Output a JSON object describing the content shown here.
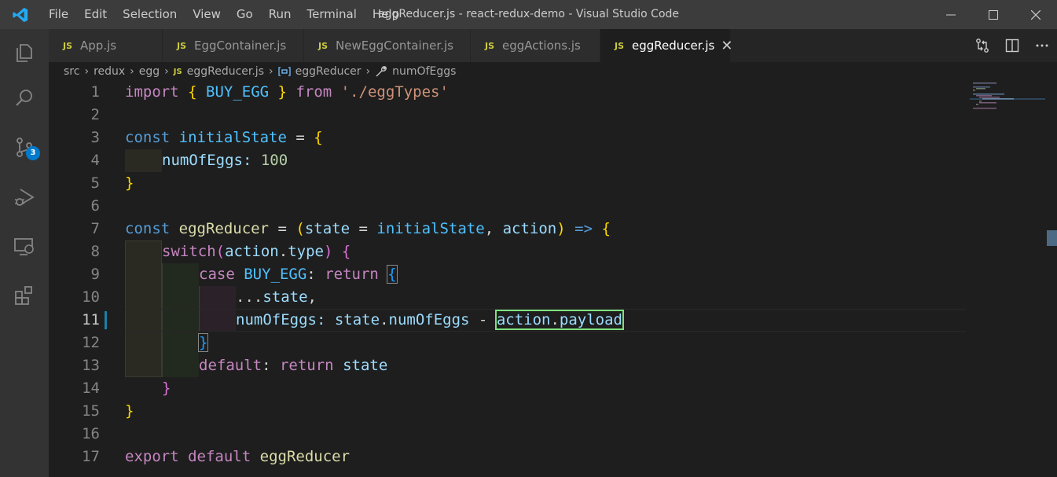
{
  "window": {
    "title": "eggReducer.js - react-redux-demo - Visual Studio Code"
  },
  "menu": [
    "File",
    "Edit",
    "Selection",
    "View",
    "Go",
    "Run",
    "Terminal",
    "Help"
  ],
  "activity": {
    "source_control_badge": "3"
  },
  "tabs": [
    {
      "label": "App.js",
      "icon": "JS"
    },
    {
      "label": "EggContainer.js",
      "icon": "JS"
    },
    {
      "label": "NewEggContainer.js",
      "icon": "JS"
    },
    {
      "label": "eggActions.js",
      "icon": "JS"
    },
    {
      "label": "eggReducer.js",
      "icon": "JS",
      "active": true
    }
  ],
  "breadcrumb": {
    "parts": [
      "src",
      "redux",
      "egg",
      "eggReducer.js",
      "eggReducer",
      "numOfEggs"
    ],
    "js_icon": "JS"
  },
  "editor": {
    "line_numbers": [
      "1",
      "2",
      "3",
      "4",
      "5",
      "6",
      "7",
      "8",
      "9",
      "10",
      "11",
      "12",
      "13",
      "14",
      "15",
      "16",
      "17"
    ],
    "active_line": "11",
    "tokens": {
      "import": "import",
      "lb": "{",
      "BUY_EGG": "BUY_EGG",
      "rb": "}",
      "from": "from",
      "path": "'./eggTypes'",
      "const": "const",
      "initialState": "initialState",
      "eq": "=",
      "numOfEggs": "numOfEggs",
      "colon": ":",
      "hundred": "100",
      "eggReducer": "eggReducer",
      "lp": "(",
      "state": "state",
      "comma": ",",
      "action": "action",
      "rp": ")",
      "arrow": "=>",
      "switch": "switch",
      "dot": ".",
      "type": "type",
      "case": "case",
      "return": "return",
      "spread": "...",
      "minus": "-",
      "payload": "payload",
      "default": "default",
      "export": "export"
    }
  }
}
